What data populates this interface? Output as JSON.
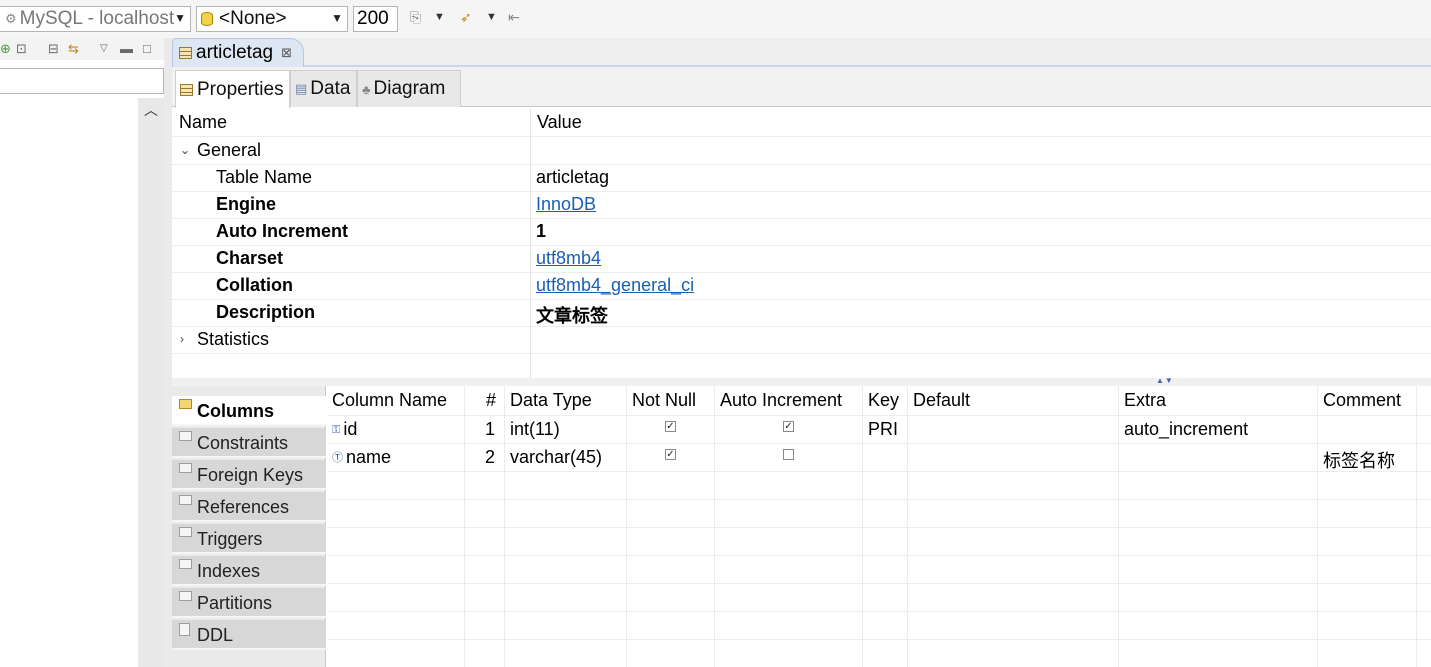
{
  "toolbar": {
    "connection_value": "MySQL - localhost",
    "database_value": "<None>",
    "limit_value": "200"
  },
  "editor": {
    "tab_title": "articletag",
    "close_glyph": "⊠"
  },
  "sub_tabs": [
    {
      "label": "Properties",
      "icon": "table-icon"
    },
    {
      "label": "Data",
      "icon": "data-icon"
    },
    {
      "label": "Diagram",
      "icon": "diagram-icon"
    }
  ],
  "properties": {
    "header_name": "Name",
    "header_value": "Value",
    "group_general": "General",
    "group_statistics": "Statistics",
    "rows": [
      {
        "name": "Table Name",
        "value": "articletag",
        "bold": false,
        "link": false
      },
      {
        "name": "Engine",
        "value": "InnoDB",
        "bold": true,
        "link": true
      },
      {
        "name": "Auto Increment",
        "value": "1",
        "bold": true,
        "link": false
      },
      {
        "name": "Charset",
        "value": "utf8mb4",
        "bold": true,
        "link": true
      },
      {
        "name": "Collation",
        "value": "utf8mb4_general_ci",
        "bold": true,
        "link": true
      },
      {
        "name": "Description",
        "value": "文章标签",
        "bold": true,
        "link": false
      }
    ]
  },
  "side_tabs": [
    "Columns",
    "Constraints",
    "Foreign Keys",
    "References",
    "Triggers",
    "Indexes",
    "Partitions",
    "DDL"
  ],
  "columns_grid": {
    "headers": [
      "Column Name",
      "#",
      "Data Type",
      "Not Null",
      "Auto Increment",
      "Key",
      "Default",
      "Extra",
      "Comment"
    ],
    "rows": [
      {
        "name": "id",
        "num": "1",
        "type": "int(11)",
        "not_null": true,
        "auto_inc": true,
        "key": "PRI",
        "default": "",
        "extra": "auto_increment",
        "comment": ""
      },
      {
        "name": "name",
        "num": "2",
        "type": "varchar(45)",
        "not_null": true,
        "auto_inc": false,
        "key": "",
        "default": "",
        "extra": "",
        "comment": "标签名称"
      }
    ]
  },
  "colors": {
    "link": "#1a5fb4",
    "tab_active": "#dde7f3"
  }
}
